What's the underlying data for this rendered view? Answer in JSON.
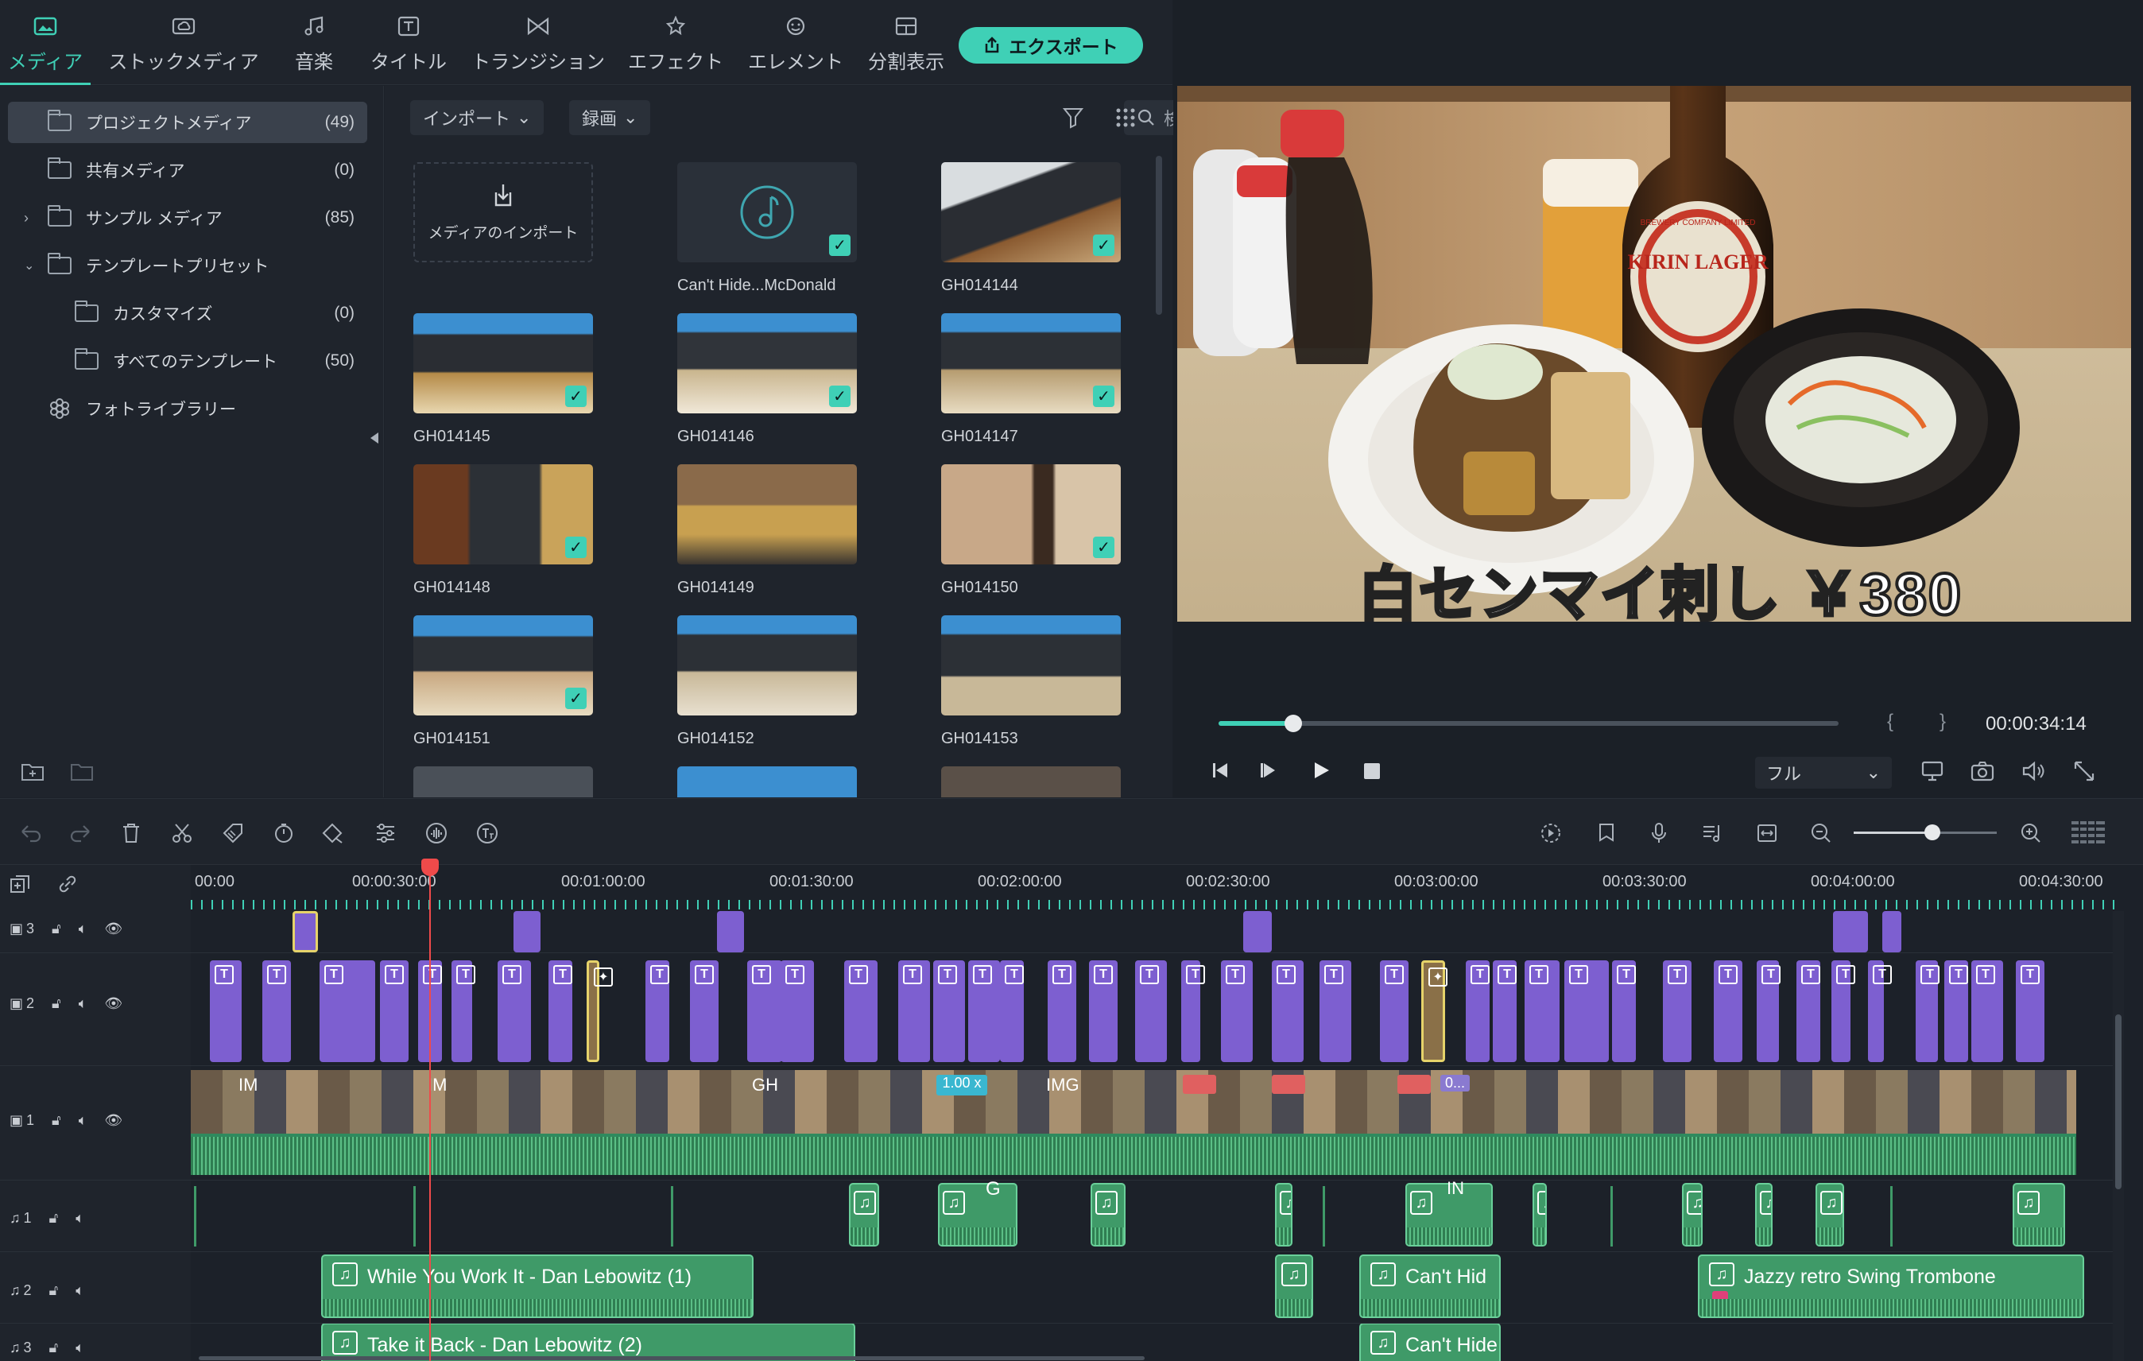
{
  "tabs": [
    {
      "label": "メディア",
      "icon": "media-icon",
      "active": true
    },
    {
      "label": "ストックメディア",
      "icon": "cloud-icon"
    },
    {
      "label": "音楽",
      "icon": "music-icon"
    },
    {
      "label": "タイトル",
      "icon": "title-icon"
    },
    {
      "label": "トランジション",
      "icon": "transition-icon"
    },
    {
      "label": "エフェクト",
      "icon": "effect-icon"
    },
    {
      "label": "エレメント",
      "icon": "element-icon"
    },
    {
      "label": "分割表示",
      "icon": "split-icon"
    }
  ],
  "export_label": "エクスポート",
  "sidebar": {
    "items": [
      {
        "label": "プロジェクトメディア",
        "count": "(49)"
      },
      {
        "label": "共有メディア",
        "count": "(0)"
      },
      {
        "label": "サンプル メディア",
        "count": "(85)"
      },
      {
        "label": "テンプレートプリセット",
        "count": ""
      },
      {
        "label": "カスタマイズ",
        "count": "(0)"
      },
      {
        "label": "すべてのテンプレート",
        "count": "(50)"
      },
      {
        "label": "フォトライブラリー",
        "count": ""
      }
    ]
  },
  "media": {
    "import_label": "インポート",
    "record_label": "録画",
    "search_placeholder": "検索",
    "import_tile_label": "メディアのインポート",
    "items": [
      "Can't Hide...McDonald",
      "GH014144",
      "GH014145",
      "GH014146",
      "GH014147",
      "GH014148",
      "GH014149",
      "GH014150",
      "GH014151",
      "GH014152",
      "GH014153"
    ]
  },
  "preview": {
    "caption": "白センマイ刺し ￥380",
    "timecode": "00:00:34:14",
    "quality": "フル",
    "progress": 0.12,
    "bottle_label_top": "BREWERY COMPANY LIMITED",
    "bottle_label": "KIRIN LAGER"
  },
  "ruler": [
    "00:00",
    "00:00:30:00",
    "00:01:00:00",
    "00:01:30:00",
    "00:02:00:00",
    "00:02:30:00",
    "00:03:00:00",
    "00:03:30:00",
    "00:04:00:00",
    "00:04:30:00"
  ],
  "tracks": [
    {
      "num": "3",
      "type": "video"
    },
    {
      "num": "2",
      "type": "video"
    },
    {
      "num": "1",
      "type": "video"
    },
    {
      "num": "1",
      "type": "audio"
    },
    {
      "num": "2",
      "type": "audio"
    },
    {
      "num": "3",
      "type": "audio"
    }
  ],
  "audio_clips": [
    "While You Work It - Dan Lebowitz (1)",
    "Can't Hid",
    "Jazzy retro Swing Trombone",
    "Take it Back - Dan Lebowitz (2)",
    "Can't Hide"
  ],
  "video_labels": [
    "IM",
    "IM",
    "IMG",
    "GH",
    "1.00 x",
    "0..."
  ],
  "audio_small_labels": [
    "G",
    "IN"
  ]
}
